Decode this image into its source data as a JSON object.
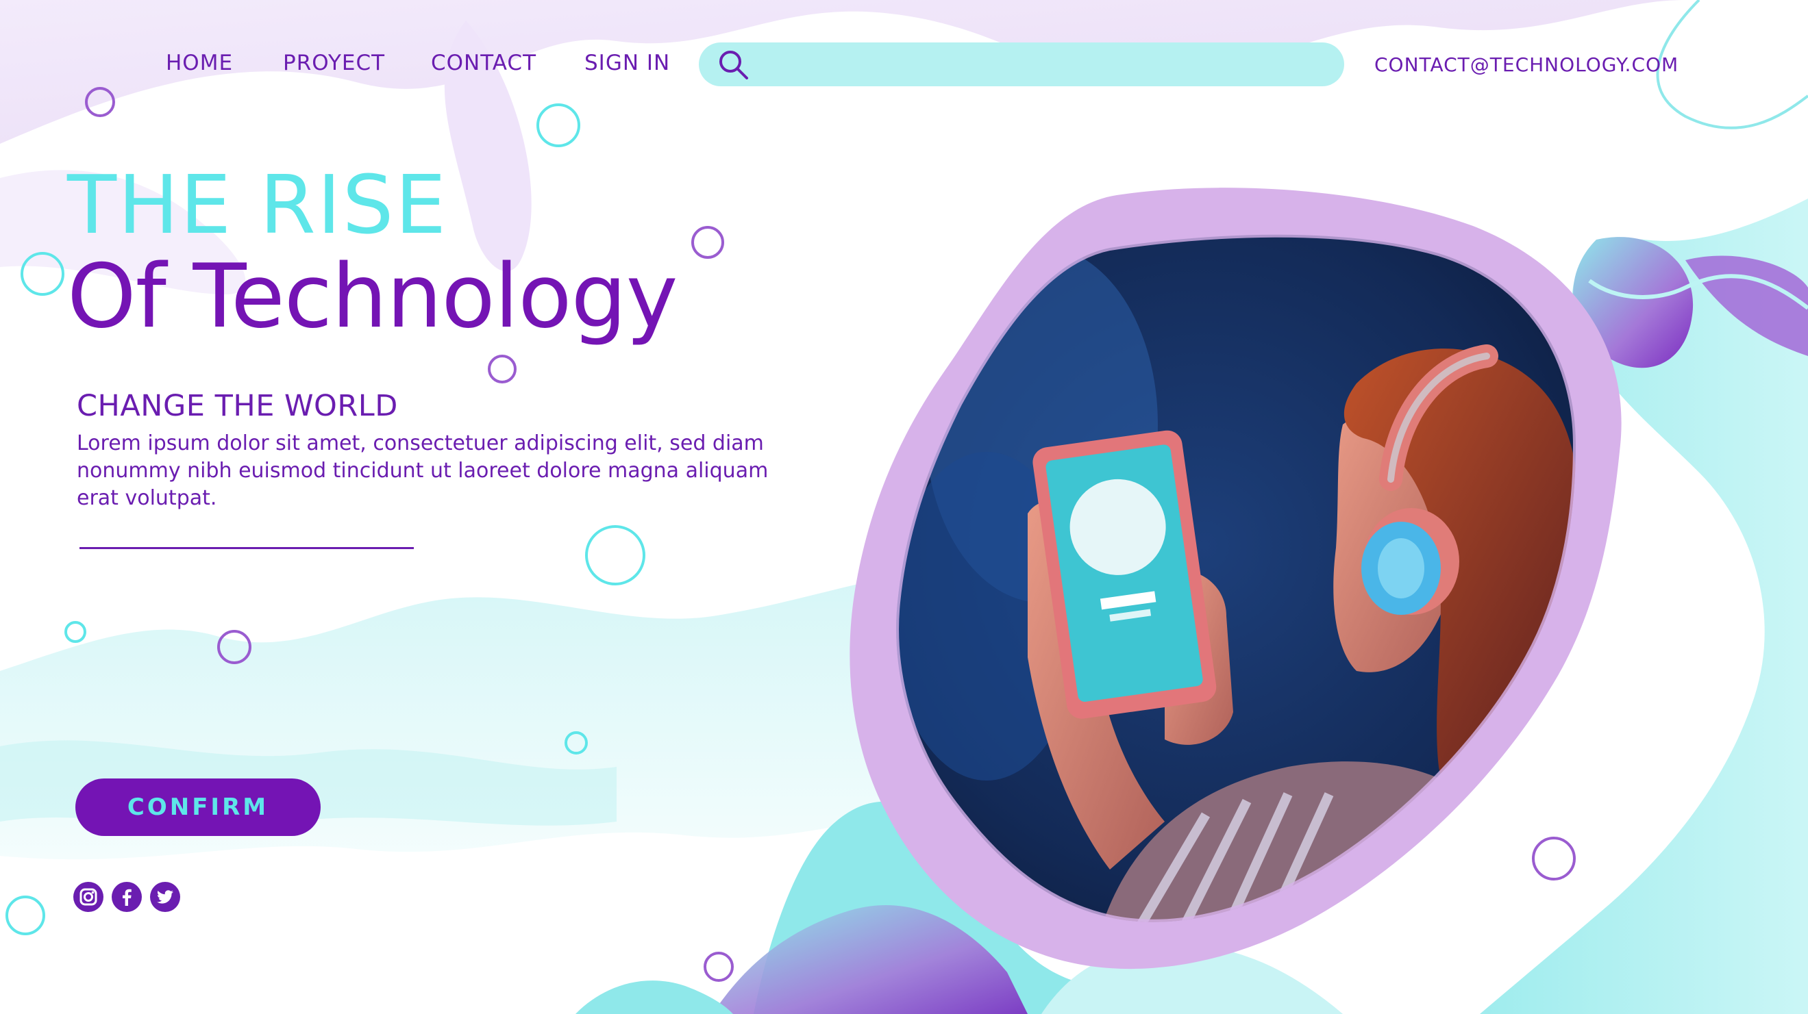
{
  "nav": {
    "items": [
      {
        "label": "HOME"
      },
      {
        "label": "PROYECT"
      },
      {
        "label": "CONTACT"
      },
      {
        "label": "SIGN IN"
      }
    ],
    "search_placeholder": "",
    "search_icon": "search-icon",
    "email": "CONTACT@TECHNOLOGY.COM"
  },
  "hero": {
    "title_line1": "THE RISE",
    "title_line2": "Of Technology",
    "subtitle": "CHANGE THE WORLD",
    "body": "Lorem ipsum dolor sit amet, consectetuer adipiscing elit, sed diam nonummy nibh euismod tincidunt ut laoreet dolore magna aliquam erat volutpat.",
    "cta_label": "CONFIRM"
  },
  "social": [
    "instagram-icon",
    "facebook-icon",
    "twitter-icon"
  ],
  "colors": {
    "purple": "#7414b4",
    "purple_light": "#d9aeea",
    "cyan": "#5ee6e9",
    "cyan_light": "#b5f1f1",
    "white": "#ffffff"
  },
  "photo": {
    "subject": "woman-with-headphones-holding-tablet"
  }
}
